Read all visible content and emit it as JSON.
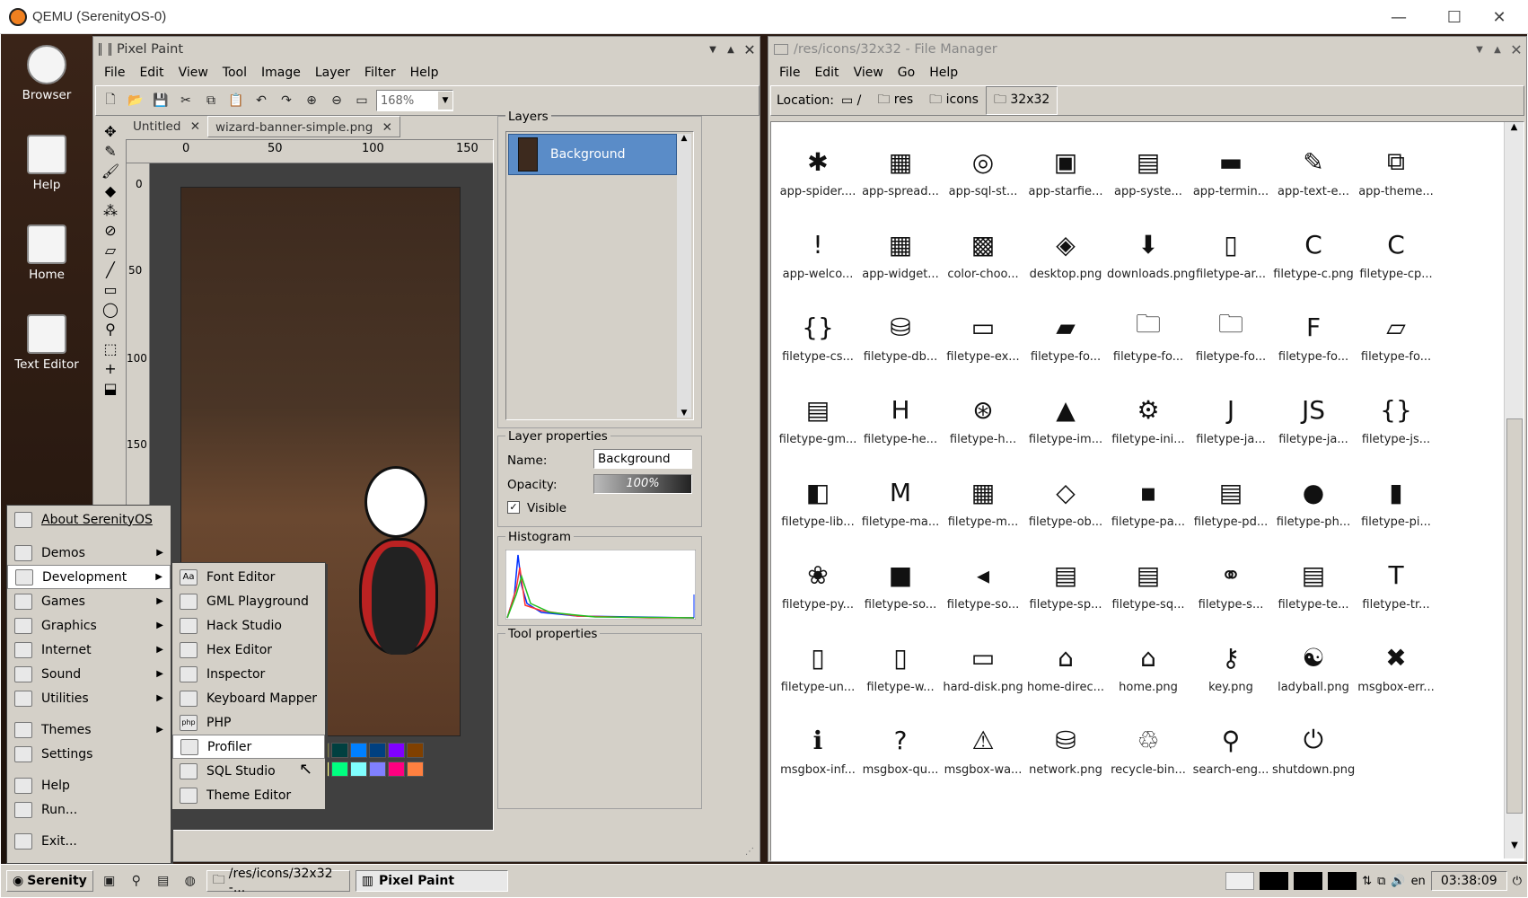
{
  "host": {
    "title": "QEMU (SerenityOS-0)",
    "minimize": "—",
    "maximize": "☐",
    "close": "✕"
  },
  "desktop_icons": [
    {
      "label": "Browser"
    },
    {
      "label": "Help"
    },
    {
      "label": "Home"
    },
    {
      "label": "Text Editor"
    }
  ],
  "pixel_paint": {
    "title": "Pixel Paint",
    "menus": [
      "File",
      "Edit",
      "View",
      "Tool",
      "Image",
      "Layer",
      "Filter",
      "Help"
    ],
    "zoom": "168%",
    "tabs": [
      "Untitled",
      "wizard-banner-simple.png"
    ],
    "ruler_h": [
      "0",
      "50",
      "100",
      "150"
    ],
    "ruler_v": [
      "0",
      "50",
      "100",
      "150"
    ],
    "layers_title": "Layers",
    "layer_name": "Background",
    "layer_props_title": "Layer properties",
    "name_label": "Name:",
    "name_value": "Background",
    "opacity_label": "Opacity:",
    "opacity_value": "100%",
    "visible_label": "Visible",
    "histogram_title": "Histogram",
    "tool_props_title": "Tool properties",
    "palette": [
      "#000000",
      "#808080",
      "#800000",
      "#808000",
      "#008000",
      "#008080",
      "#000080",
      "#800080",
      "#808040",
      "#004040",
      "#0080ff",
      "#004080",
      "#8000ff",
      "#804000",
      "#ffffff",
      "#c0c0c0",
      "#ff0000",
      "#ffff00",
      "#00ff00",
      "#00ffff",
      "#0000ff",
      "#ff00ff",
      "#ffff80",
      "#00ff80",
      "#80ffff",
      "#8080ff",
      "#ff0080",
      "#ff8040"
    ]
  },
  "file_manager": {
    "title": "/res/icons/32x32 - File Manager",
    "menus": [
      "File",
      "Edit",
      "View",
      "Go",
      "Help"
    ],
    "location_label": "Location:",
    "crumbs": [
      "/",
      "res",
      "icons",
      "32x32"
    ],
    "items": [
      "app-spider....",
      "app-spread...",
      "app-sql-st...",
      "app-starfie...",
      "app-syste...",
      "app-termin...",
      "app-text-e...",
      "app-theme...",
      "app-welco...",
      "app-widget...",
      "color-choo...",
      "desktop.png",
      "downloads.png",
      "filetype-ar...",
      "filetype-c.png",
      "filetype-cp...",
      "filetype-cs...",
      "filetype-db...",
      "filetype-ex...",
      "filetype-fo...",
      "filetype-fo...",
      "filetype-fo...",
      "filetype-fo...",
      "filetype-fo...",
      "filetype-gm...",
      "filetype-he...",
      "filetype-h...",
      "filetype-im...",
      "filetype-ini...",
      "filetype-ja...",
      "filetype-ja...",
      "filetype-js...",
      "filetype-lib...",
      "filetype-ma...",
      "filetype-m...",
      "filetype-ob...",
      "filetype-pa...",
      "filetype-pd...",
      "filetype-ph...",
      "filetype-pi...",
      "filetype-py...",
      "filetype-so...",
      "filetype-so...",
      "filetype-sp...",
      "filetype-sq...",
      "filetype-s...",
      "filetype-te...",
      "filetype-tr...",
      "filetype-un...",
      "filetype-w...",
      "hard-disk.png",
      "home-direc...",
      "home.png",
      "key.png",
      "ladyball.png",
      "msgbox-err...",
      "msgbox-inf...",
      "msgbox-qu...",
      "msgbox-wa...",
      "network.png",
      "recycle-bin...",
      "search-eng...",
      "shutdown.png"
    ]
  },
  "start_menu": {
    "items": [
      "About SerenityOS",
      "Demos",
      "Development",
      "Games",
      "Graphics",
      "Internet",
      "Sound",
      "Utilities",
      "Themes",
      "Settings",
      "Help",
      "Run...",
      "Exit..."
    ]
  },
  "dev_menu": {
    "items": [
      "Font Editor",
      "GML Playground",
      "Hack Studio",
      "Hex Editor",
      "Inspector",
      "Keyboard Mapper",
      "PHP",
      "Profiler",
      "SQL Studio",
      "Theme Editor"
    ]
  },
  "taskbar": {
    "start": "Serenity",
    "tasks": [
      "/res/icons/32x32 -...",
      "Pixel Paint"
    ],
    "lang": "en",
    "clock": "03:38:09"
  }
}
